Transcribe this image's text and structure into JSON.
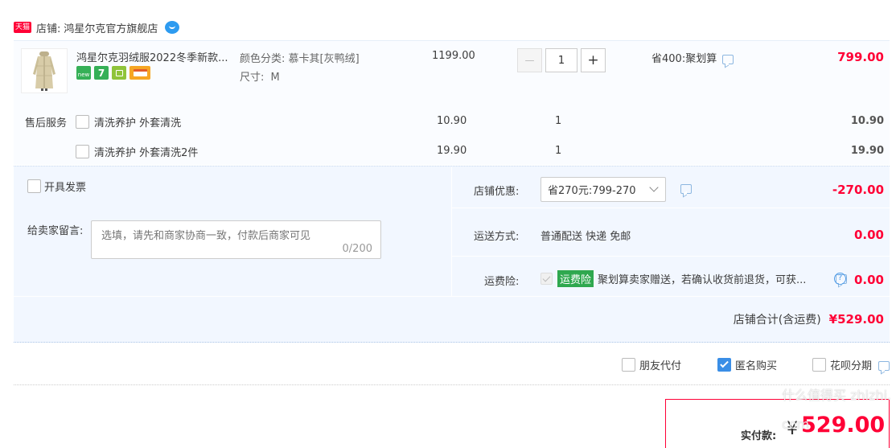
{
  "shop": {
    "badge": "天猫",
    "label": "店铺:",
    "name": "鸿星尔克官方旗舰店"
  },
  "item": {
    "title": "鸿星尔克羽绒服2022冬季新款...",
    "color_label": "颜色分类:",
    "color_value": "慕卡其[灰鸭绒]",
    "size_label": "尺寸:",
    "size_value": "M",
    "unit_price": "1199.00",
    "quantity": "1",
    "minus": "—",
    "plus": "+",
    "promo": "省400:聚划算",
    "subtotal": "799.00",
    "tag_new": "new",
    "tag_seven": "7"
  },
  "after_sales": {
    "label": "售后服务",
    "services": [
      {
        "name": "清洗养护 外套清洗",
        "price": "10.90",
        "qty": "1",
        "total": "10.90"
      },
      {
        "name": "清洗养护 外套清洗2件",
        "price": "19.90",
        "qty": "1",
        "total": "19.90"
      }
    ]
  },
  "invoice": {
    "label": "开具发票"
  },
  "message": {
    "label": "给卖家留言:",
    "placeholder": "选填，请先和商家协商一致，付款后商家可见",
    "counter": "0/200"
  },
  "discount": {
    "label": "店铺优惠:",
    "selected": "省270元:799-270",
    "amount": "-270.00"
  },
  "shipping": {
    "label": "运送方式:",
    "value": "普通配送 快递 免邮",
    "amount": "0.00"
  },
  "insurance": {
    "label": "运费险:",
    "tag": "运费险",
    "text": "聚划算卖家赠送，若确认收货前退货，可获...",
    "amount": "0.00"
  },
  "shop_total": {
    "label": "店铺合计(含运费)",
    "amount": "¥529.00"
  },
  "options": {
    "friend_pay": "朋友代付",
    "anonymous": "匿名购买",
    "huabei": "花呗分期"
  },
  "payable": {
    "label": "实付款:",
    "currency": "¥",
    "amount": "529.00"
  },
  "watermark": "什么值得买 zhizhi.com",
  "colors": {
    "accent_red": "#ff0036",
    "link_blue": "#3a8ee6",
    "panel_bg": "#f5f8fc"
  }
}
